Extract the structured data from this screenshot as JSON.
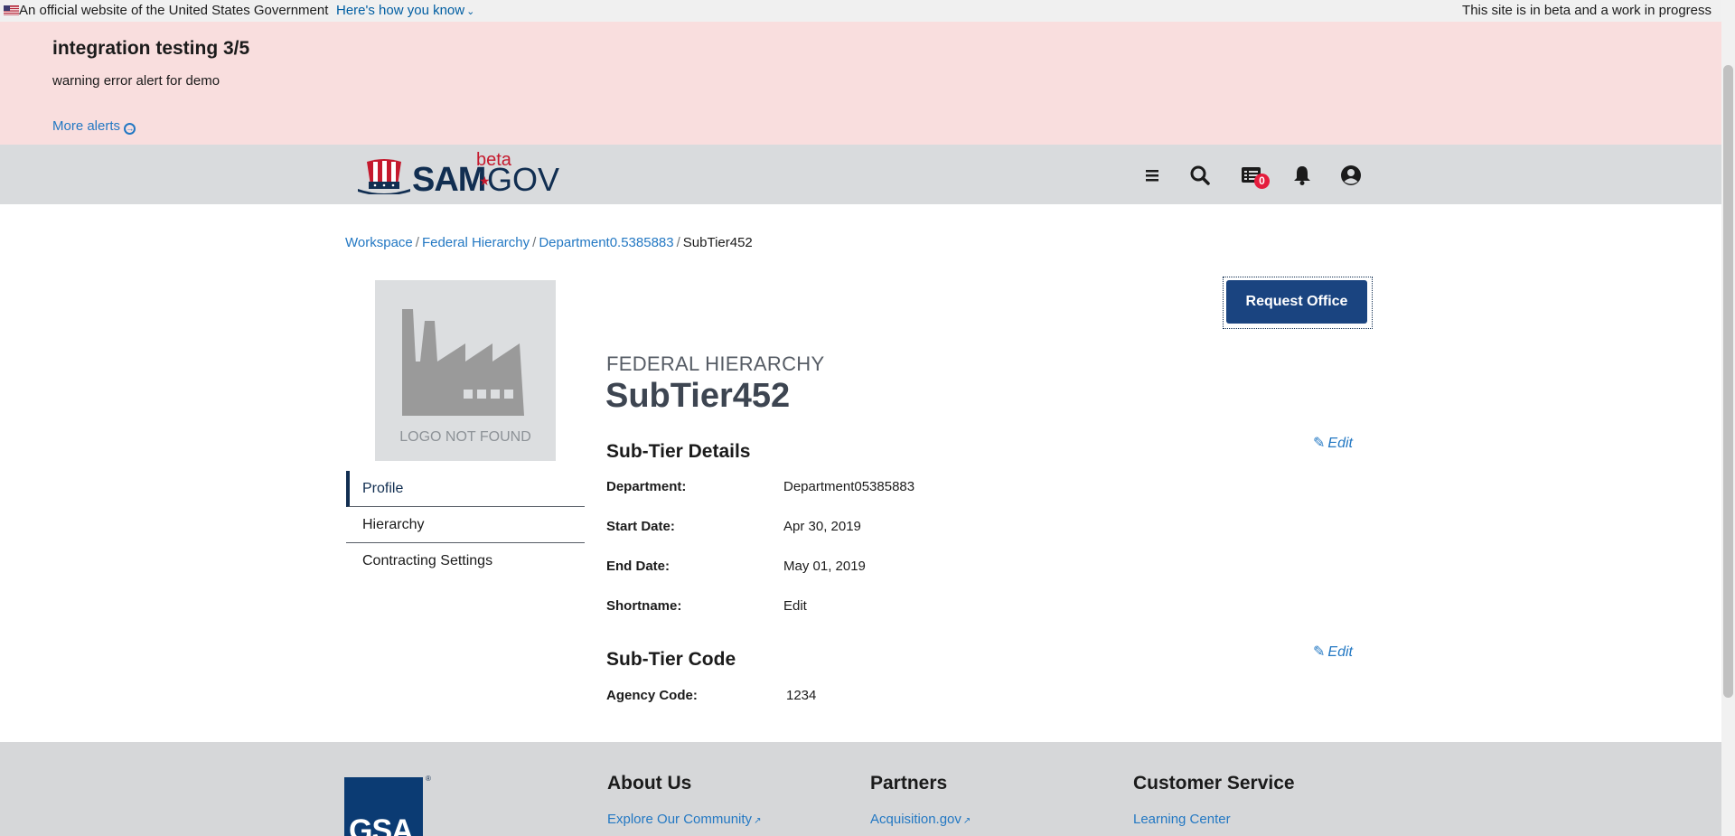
{
  "gov_banner": {
    "official_text": "An official website of the United States Government",
    "how_you_know": "Here's how you know",
    "beta_notice": "This site is in beta and a work in progress"
  },
  "alert": {
    "title": "integration testing 3/5",
    "message": "warning error alert for demo",
    "more_link": "More alerts"
  },
  "header": {
    "logo_sam": "SAM",
    "logo_gov": "GOV",
    "logo_beta": "beta",
    "messages_badge": "0",
    "icons": [
      "menu-icon",
      "search-icon",
      "messages-icon",
      "notifications-icon",
      "account-icon"
    ]
  },
  "breadcrumb": {
    "items": [
      "Workspace",
      "Federal Hierarchy",
      "Department0.5385883"
    ],
    "current": "SubTier452",
    "separator": "/"
  },
  "logo_placeholder": "LOGO NOT FOUND",
  "sidenav": {
    "items": [
      "Profile",
      "Hierarchy",
      "Contracting Settings"
    ],
    "active": "Profile"
  },
  "request_button": "Request Office",
  "page": {
    "eyebrow": "FEDERAL HIERARCHY",
    "title": "SubTier452"
  },
  "details": {
    "title": "Sub-Tier Details",
    "edit": "Edit",
    "rows": [
      {
        "label": "Department:",
        "value": "Department05385883"
      },
      {
        "label": "Start Date:",
        "value": "Apr 30, 2019"
      },
      {
        "label": "End Date:",
        "value": "May 01, 2019"
      },
      {
        "label": "Shortname:",
        "value": "Edit"
      }
    ]
  },
  "code": {
    "title": "Sub-Tier Code",
    "edit": "Edit",
    "rows": [
      {
        "label": "Agency Code:",
        "value": "1234"
      }
    ]
  },
  "footer": {
    "gsa_logo": "GSA",
    "columns": [
      {
        "title": "About Us",
        "link": "Explore Our Community"
      },
      {
        "title": "Partners",
        "link": "Acquisition.gov"
      },
      {
        "title": "Customer Service",
        "link": "Learning Center"
      }
    ]
  },
  "colors": {
    "alert_bg": "#f9dede",
    "header_bg": "#d9dbdd",
    "primary_button": "#1a4480",
    "link": "#2378c3",
    "brand_red": "#c5192d",
    "brand_navy": "#112e51"
  }
}
